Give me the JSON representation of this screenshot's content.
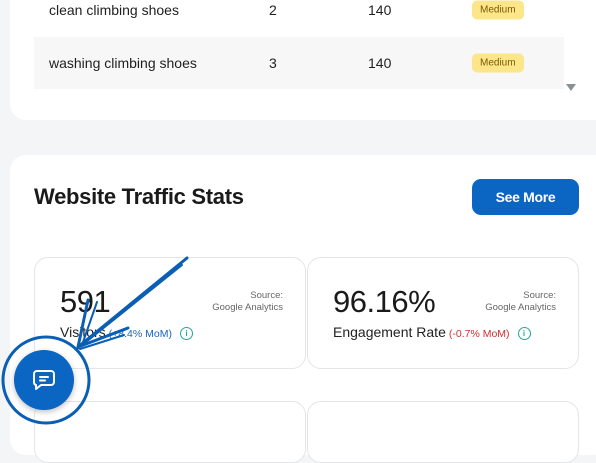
{
  "keywords_table": {
    "rows": [
      {
        "keyword": "clean climbing shoes",
        "position": "2",
        "volume": "140",
        "difficulty": "Medium"
      },
      {
        "keyword": "washing climbing shoes",
        "position": "3",
        "volume": "140",
        "difficulty": "Medium"
      }
    ]
  },
  "traffic": {
    "title": "Website Traffic Stats",
    "see_more_label": "See More",
    "stats": [
      {
        "value": "591",
        "label": "Visitors",
        "change": "(+8.4% MoM)",
        "source_line1": "Source:",
        "source_line2": "Google Analytics"
      },
      {
        "value": "96.16%",
        "label": "Engagement Rate",
        "change": "(-0.7% MoM)",
        "source_line1": "Source:",
        "source_line2": "Google Analytics"
      }
    ]
  },
  "icons": {
    "info": "info-circle-icon",
    "chat": "chat-bubble-icon",
    "scroll": "triangle-down-icon"
  },
  "colors": {
    "primary": "#0a66c2",
    "badge_bg": "#fde68a",
    "positive_change": "#1565c0",
    "negative_change": "#d32f2f",
    "info_icon": "#26a69a"
  }
}
